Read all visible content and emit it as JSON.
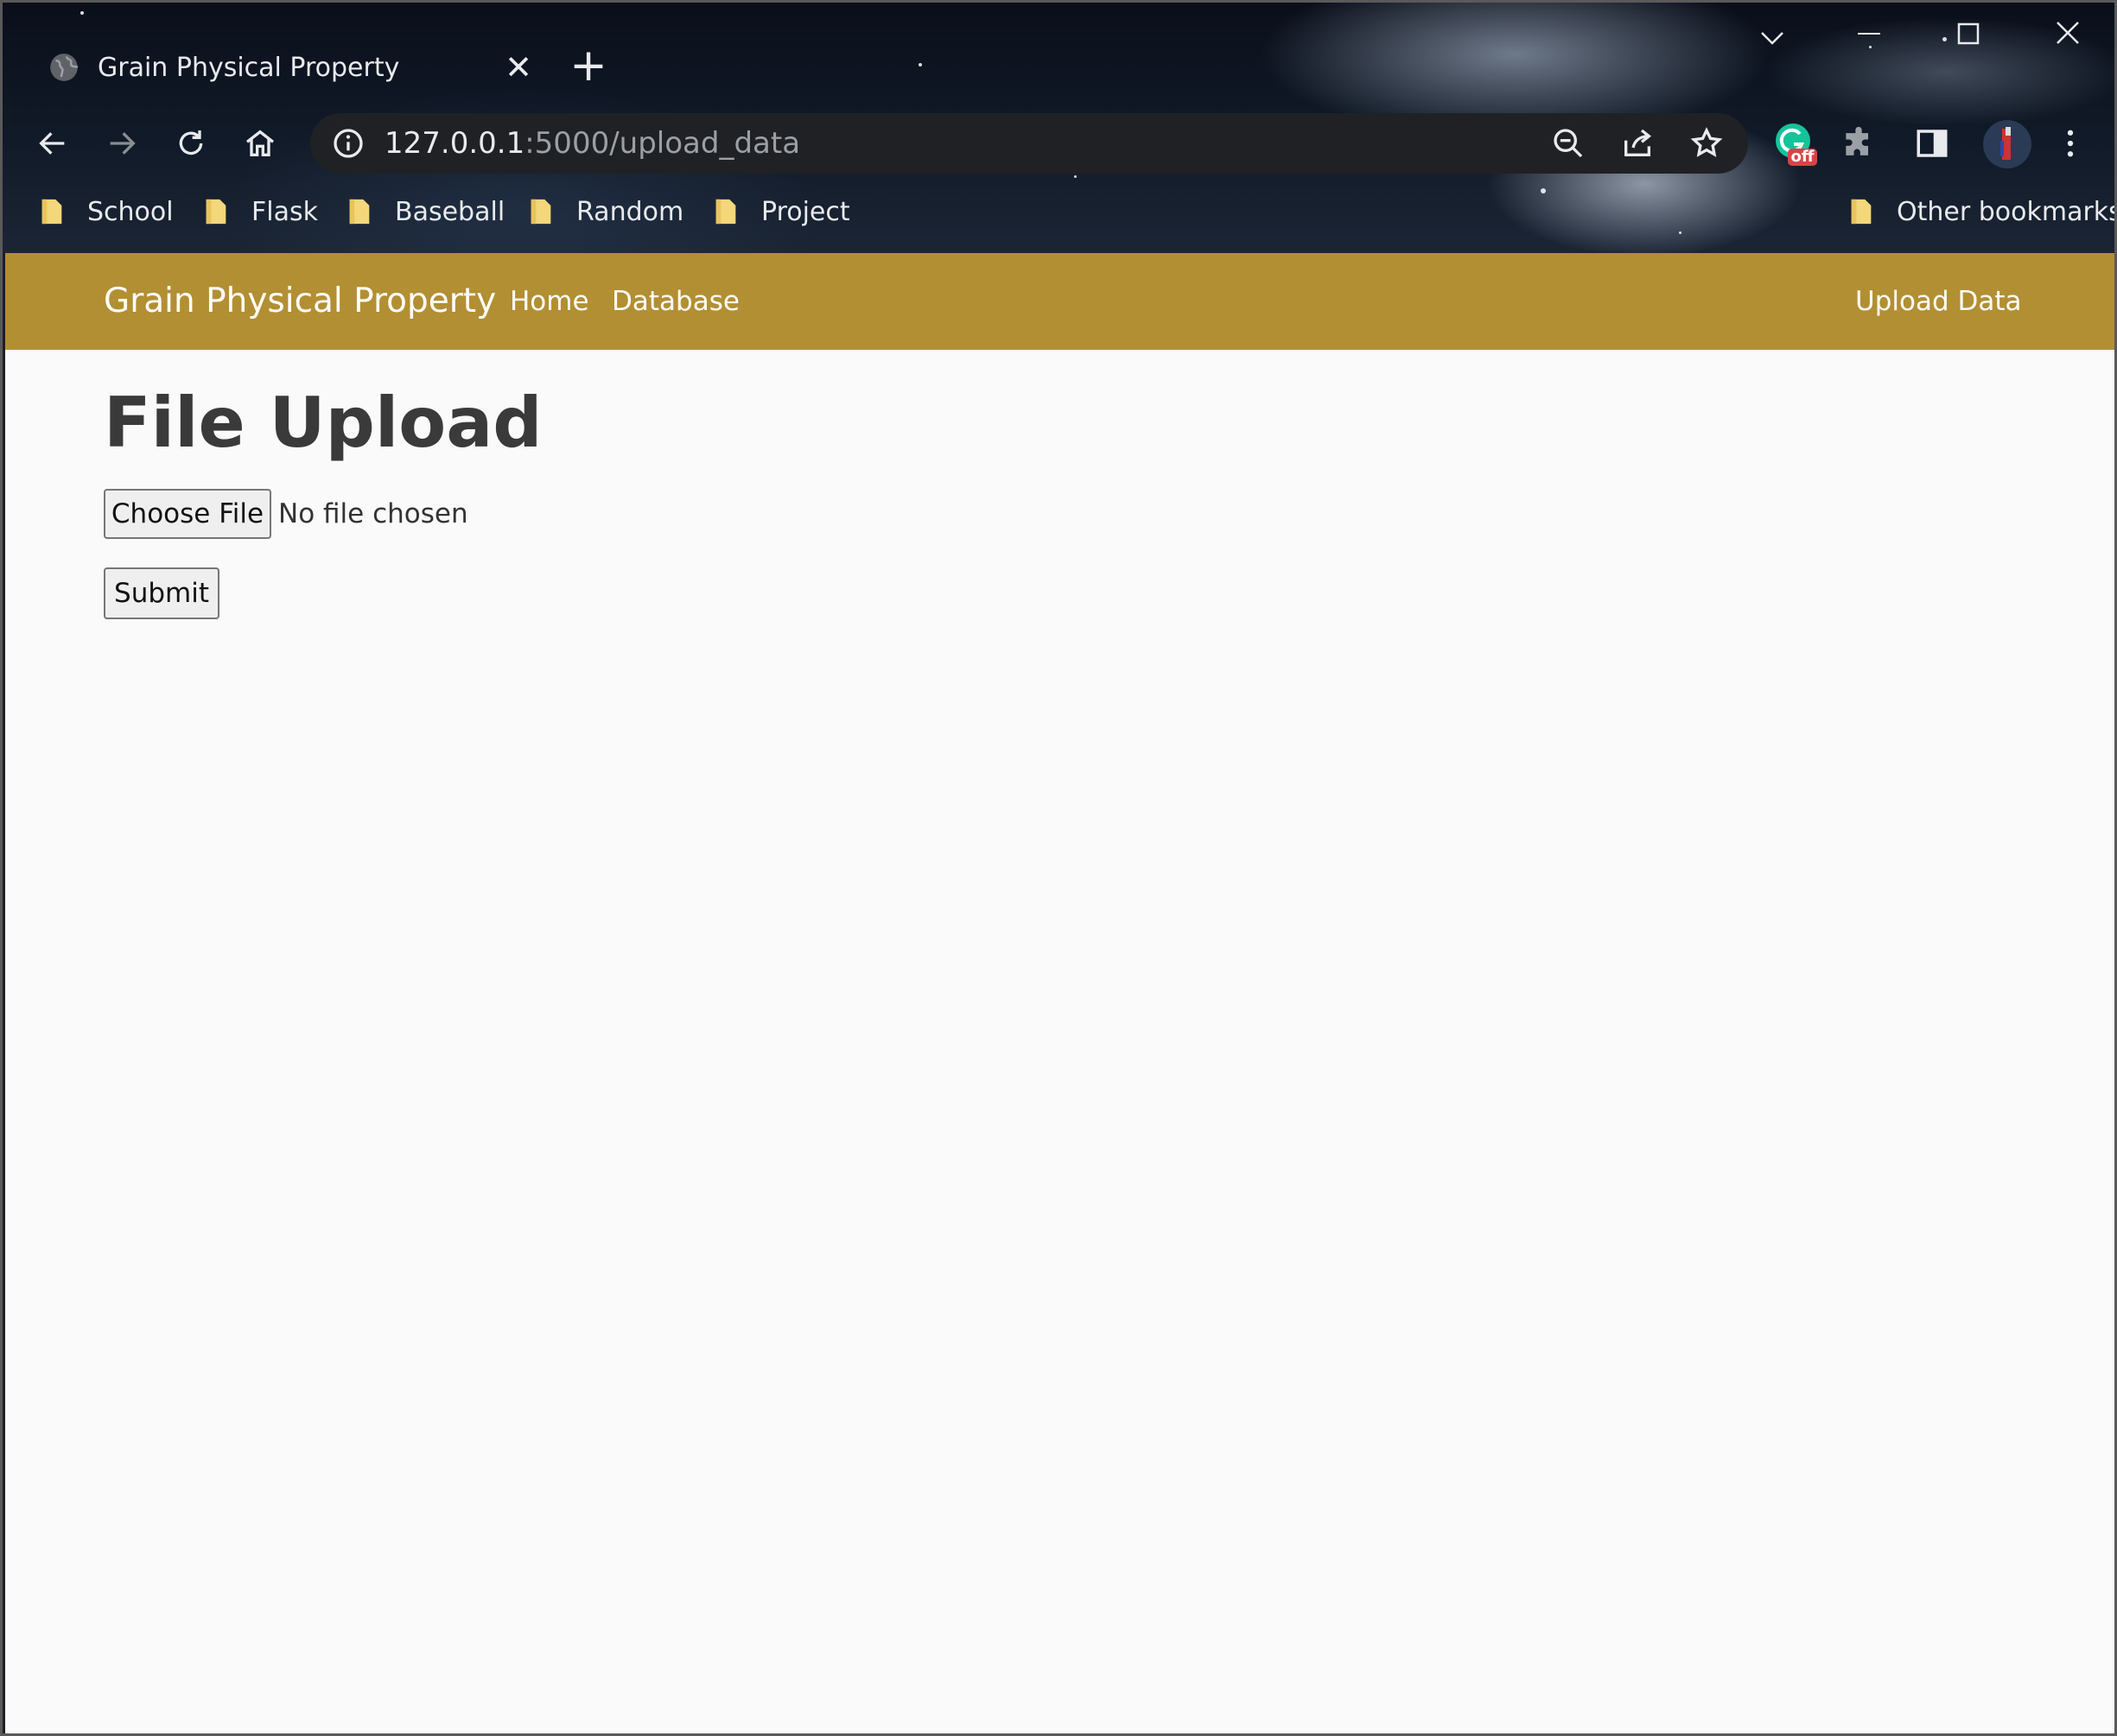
{
  "browser": {
    "tab_title": "Grain Physical Property",
    "url_host": "127.0.0.1",
    "url_path": ":5000/upload_data",
    "extension_badge": "off",
    "bookmarks": [
      {
        "label": "School"
      },
      {
        "label": "Flask"
      },
      {
        "label": "Baseball"
      },
      {
        "label": "Random"
      },
      {
        "label": "Project"
      }
    ],
    "other_bookmarks": "Other bookmarks"
  },
  "navbar": {
    "brand": "Grain Physical Property",
    "links": [
      {
        "label": "Home"
      },
      {
        "label": "Database"
      }
    ],
    "right_link": "Upload Data",
    "color": "#b38f33"
  },
  "main": {
    "heading": "File Upload",
    "choose_file_label": "Choose File",
    "file_status": "No file chosen",
    "submit_label": "Submit"
  }
}
